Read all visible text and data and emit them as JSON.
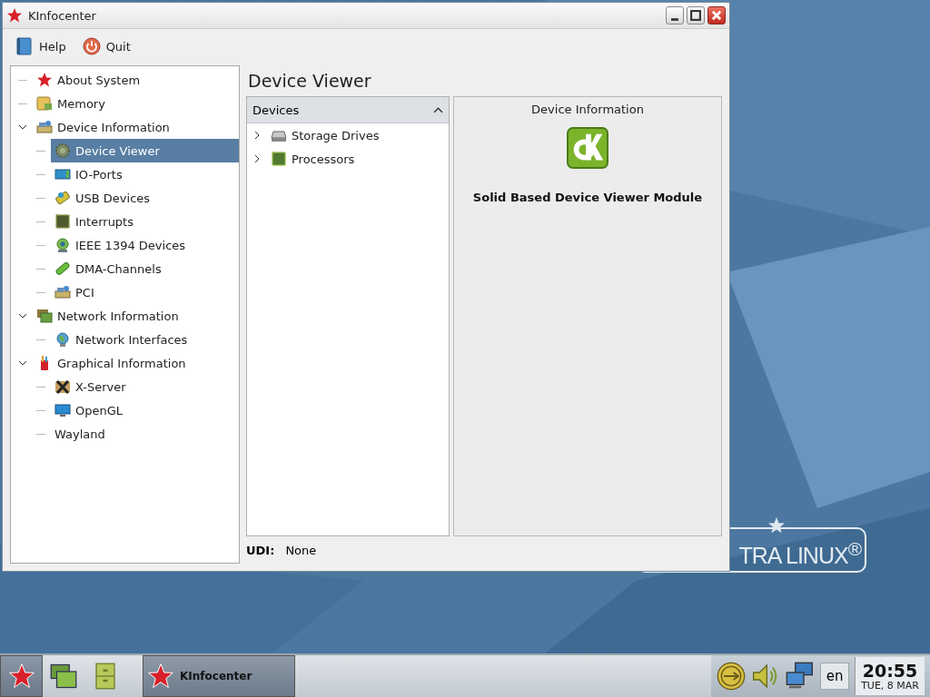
{
  "window": {
    "title": "KInfocenter"
  },
  "toolbar": [
    {
      "label": "Help",
      "kind": "help"
    },
    {
      "label": "Quit",
      "kind": "quit"
    }
  ],
  "tree": [
    {
      "label": "About System",
      "selected": false
    },
    {
      "label": "Memory",
      "selected": false
    },
    {
      "label": "Device Information",
      "selected": false,
      "expanded": true,
      "children": [
        {
          "label": "Device Viewer",
          "selected": true
        },
        {
          "label": "IO-Ports",
          "selected": false
        },
        {
          "label": "USB Devices",
          "selected": false
        },
        {
          "label": "Interrupts",
          "selected": false
        },
        {
          "label": "IEEE 1394 Devices",
          "selected": false
        },
        {
          "label": "DMA-Channels",
          "selected": false
        },
        {
          "label": "PCI",
          "selected": false
        }
      ]
    },
    {
      "label": "Network Information",
      "selected": false,
      "expanded": true,
      "children": [
        {
          "label": "Network Interfaces",
          "selected": false
        }
      ]
    },
    {
      "label": "Graphical Information",
      "selected": false,
      "expanded": true,
      "children": [
        {
          "label": "X-Server",
          "selected": false
        },
        {
          "label": "OpenGL",
          "selected": false
        },
        {
          "label": "Wayland",
          "selected": false
        }
      ]
    }
  ],
  "page": {
    "title": "Device Viewer",
    "devices": {
      "header": "Devices",
      "expanded": true,
      "items": [
        {
          "label": "Storage Drives",
          "expanded": false
        },
        {
          "label": "Processors",
          "expanded": false
        }
      ]
    },
    "info": {
      "title": "Device Information",
      "module": "Solid Based Device Viewer Module"
    },
    "udi": {
      "label": "UDI:",
      "value": "None"
    }
  },
  "wallpaper": {
    "logo": "TRA LINUX$^{®}$"
  },
  "taskbar": {
    "tasks": [
      {
        "label": "KInfocenter"
      }
    ],
    "language": "en",
    "time": "20:55",
    "date": "TUE, 8 MAR"
  }
}
